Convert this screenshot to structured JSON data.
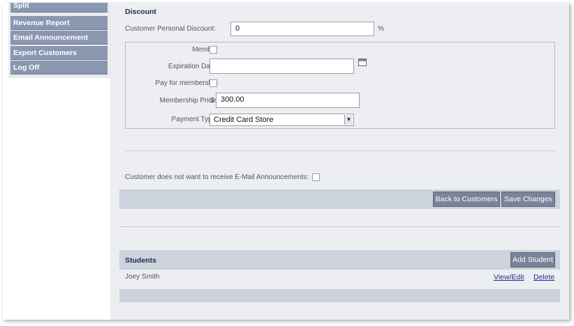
{
  "sidebar": {
    "items": [
      {
        "label": "Split"
      },
      {
        "label": "Revenue Report"
      },
      {
        "label": "Email Announcement"
      },
      {
        "label": "Export Customers"
      },
      {
        "label": "Log Off"
      }
    ]
  },
  "discount": {
    "heading": "Discount",
    "personal_label": "Customer Personal Discount:",
    "personal_value": "0",
    "personal_unit": "%",
    "member_label": "Member",
    "expiration_label": "Expiration Date:",
    "expiration_value": "",
    "pay_label": "Pay for membership",
    "price_label": "Membership Price:",
    "price_currency": "$",
    "price_value": "300.00",
    "payment_label": "Payment Type:",
    "payment_value": "Credit Card Store"
  },
  "announcements": {
    "optout_label": "Customer does not want to receive E-Mail Announcements:"
  },
  "actions": {
    "back_label": "Back to Customers",
    "save_label": "Save Changes"
  },
  "students": {
    "heading": "Students",
    "add_label": "Add Student",
    "rows": [
      {
        "name": "Joey Smith",
        "view_label": "View/Edit",
        "delete_label": "Delete"
      }
    ]
  },
  "colors": {
    "nav_bg": "#8b97b0",
    "content_bg": "#edeef1",
    "bar_bg": "#ccd3dd",
    "button_bg": "#7a8499",
    "link": "#1a2f8c"
  },
  "icons": [
    "calendar-icon",
    "chevron-down-icon"
  ]
}
